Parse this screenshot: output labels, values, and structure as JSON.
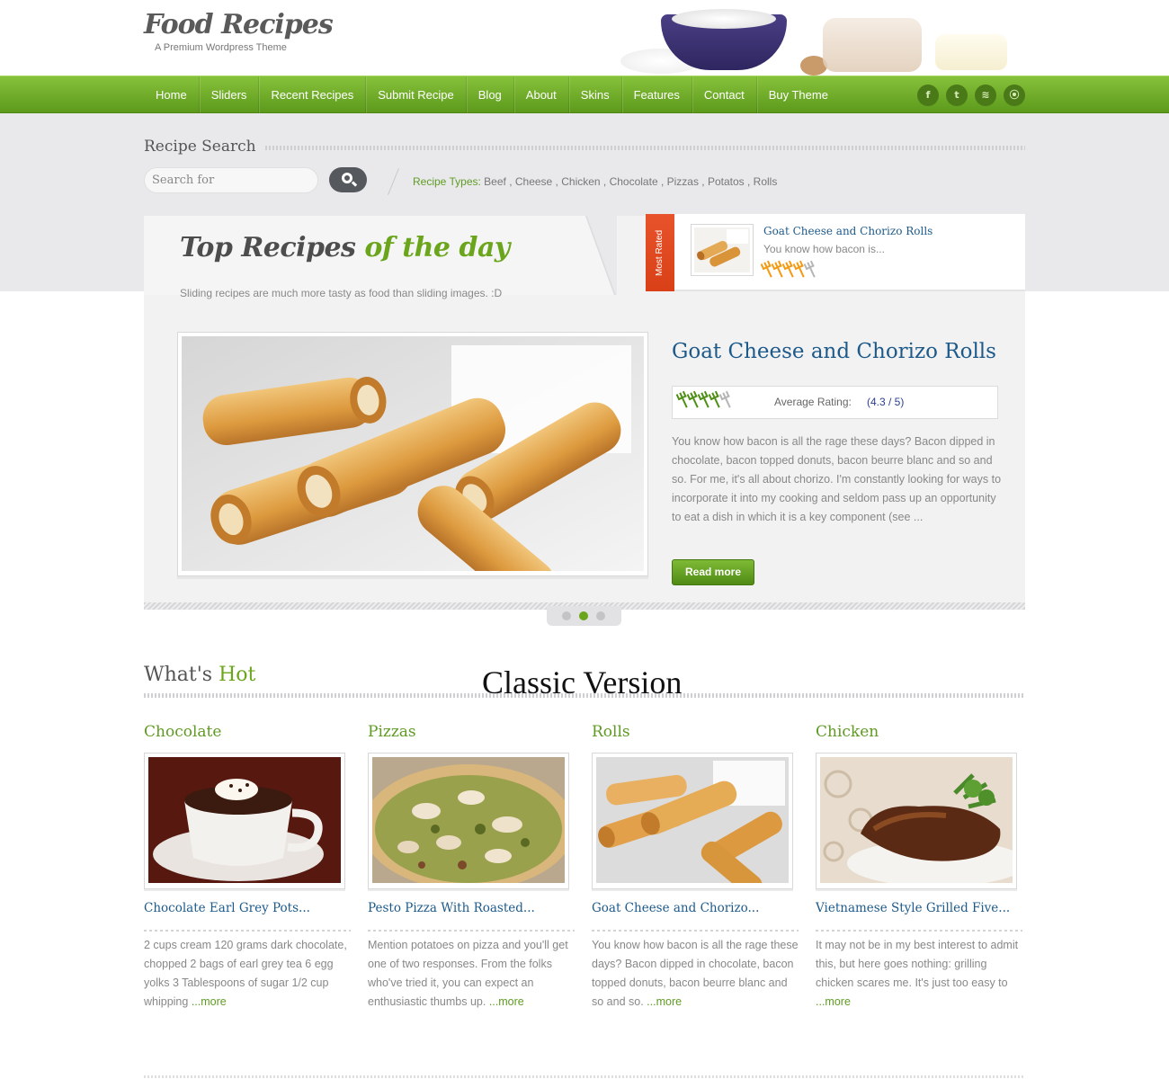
{
  "brand": {
    "title": "Food Recipes",
    "tagline": "A Premium Wordpress Theme"
  },
  "nav": {
    "items": [
      "Home",
      "Sliders",
      "Recent Recipes",
      "Submit Recipe",
      "Blog",
      "About",
      "Skins",
      "Features",
      "Contact",
      "Buy Theme"
    ],
    "social": [
      {
        "icon": "facebook-icon",
        "glyph": "f"
      },
      {
        "icon": "twitter-icon",
        "glyph": "t"
      },
      {
        "icon": "rss-icon",
        "glyph": "≋"
      },
      {
        "icon": "flickr-icon",
        "glyph": "⦿"
      }
    ]
  },
  "search": {
    "heading": "Recipe Search",
    "placeholder": "Search for",
    "types_label": "Recipe Types:",
    "types_list": "Beef , Cheese , Chicken , Chocolate , Pizzas , Potatos , Rolls"
  },
  "top_recipes": {
    "title_part1": "Top Recipes",
    "title_part2": "of the day",
    "subtitle": "Sliding recipes are much more tasty as food than sliding images. :D"
  },
  "most_rated": {
    "ribbon": "Most Rated",
    "title": "Goat Cheese and Chorizo Rolls",
    "desc": "You know how bacon is...",
    "rating_forks": 4,
    "rating_total": 5
  },
  "slide": {
    "title": "Goat Cheese and Chorizo Rolls",
    "rating_label": "Average Rating:",
    "rating_value": "(4.3 / 5)",
    "rating_forks": 4,
    "rating_total": 5,
    "description": "You know how bacon is all the rage these days? Bacon dipped in chocolate, bacon topped donuts, bacon beurre blanc and so and so. For me, it's all about chorizo. I'm constantly looking for ways to incorporate it into my cooking and seldom pass up an opportunity to eat a dish in which it is a key component (see ...",
    "read_more": "Read more",
    "pager_count": 3,
    "pager_active": 2
  },
  "hot": {
    "heading_part1": "What's",
    "heading_part2": "Hot",
    "overlay_caption": "Classic Version",
    "cards": [
      {
        "category": "Chocolate",
        "title": "Chocolate Earl Grey Pots...",
        "desc": "2 cups cream 120 grams dark chocolate, chopped 2 bags of earl grey tea 6 egg yolks 3 Tablespoons of sugar 1/2 cup whipping",
        "more": "...more"
      },
      {
        "category": "Pizzas",
        "title": "Pesto Pizza With Roasted...",
        "desc": "Mention potatoes on pizza and you'll get one of two responses. From the folks who've tried it, you can expect an enthusiastic thumbs up.",
        "more": "...more"
      },
      {
        "category": "Rolls",
        "title": "Goat Cheese and Chorizo...",
        "desc": "You know how bacon is all the rage these days? Bacon dipped in chocolate, bacon topped donuts, bacon beurre blanc and so and so.",
        "more": "...more"
      },
      {
        "category": "Chicken",
        "title": "Vietnamese Style Grilled Five...",
        "desc": "It may not be in my best interest to admit this, but here goes nothing: grilling chicken scares me. It's just too easy to",
        "more": "...more"
      }
    ]
  },
  "colors": {
    "accent_green": "#6aa51c",
    "link_blue": "#1d5a8a",
    "ribbon_red": "#d94017",
    "fork_orange": "#f39a12"
  }
}
